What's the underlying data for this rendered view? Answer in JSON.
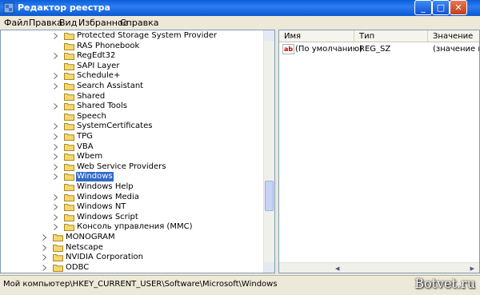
{
  "window": {
    "title": "Редактор реестра",
    "minimize_glyph": "_",
    "maximize_glyph": "□",
    "close_glyph": "✕"
  },
  "menu": [
    "Файл",
    "Правка",
    "Вид",
    "Избранное",
    "Справка"
  ],
  "tree": {
    "items": [
      {
        "label": "Protected Storage System Provider",
        "expandable": true,
        "selected": false
      },
      {
        "label": "RAS Phonebook",
        "expandable": false,
        "selected": false
      },
      {
        "label": "RegEdt32",
        "expandable": true,
        "selected": false
      },
      {
        "label": "SAPI Layer",
        "expandable": false,
        "selected": false
      },
      {
        "label": "Schedule+",
        "expandable": true,
        "selected": false
      },
      {
        "label": "Search Assistant",
        "expandable": true,
        "selected": false
      },
      {
        "label": "Shared",
        "expandable": false,
        "selected": false
      },
      {
        "label": "Shared Tools",
        "expandable": true,
        "selected": false
      },
      {
        "label": "Speech",
        "expandable": false,
        "selected": false
      },
      {
        "label": "SystemCertificates",
        "expandable": true,
        "selected": false
      },
      {
        "label": "TPG",
        "expandable": true,
        "selected": false
      },
      {
        "label": "VBA",
        "expandable": true,
        "selected": false
      },
      {
        "label": "Wbem",
        "expandable": true,
        "selected": false
      },
      {
        "label": "Web Service Providers",
        "expandable": true,
        "selected": false
      },
      {
        "label": "Windows",
        "expandable": true,
        "selected": true
      },
      {
        "label": "Windows Help",
        "expandable": false,
        "selected": false
      },
      {
        "label": "Windows Media",
        "expandable": true,
        "selected": false
      },
      {
        "label": "Windows NT",
        "expandable": true,
        "selected": false
      },
      {
        "label": "Windows Script",
        "expandable": true,
        "selected": false
      },
      {
        "label": "Консоль управления (MMC)",
        "expandable": true,
        "selected": false
      }
    ],
    "top_items": [
      {
        "label": "MONOGRAM",
        "expandable": true
      },
      {
        "label": "Netscape",
        "expandable": true
      },
      {
        "label": "NVIDIA Corporation",
        "expandable": true
      },
      {
        "label": "ODBC",
        "expandable": true
      }
    ]
  },
  "values": {
    "columns": [
      "Имя",
      "Тип",
      "Значение"
    ],
    "rows": [
      {
        "icon": "ab-string-icon",
        "icon_text": "ab",
        "name": "(По умолчанию)",
        "type": "REG_SZ",
        "data": "(значение не"
      }
    ]
  },
  "status": {
    "path": "Мой компьютер\\HKEY_CURRENT_USER\\Software\\Microsoft\\Windows"
  },
  "watermark": "Botvet.ru",
  "colors": {
    "title_bar": "#0A5FD8",
    "selection": "#316AC5",
    "folder": "#F6D76B"
  }
}
